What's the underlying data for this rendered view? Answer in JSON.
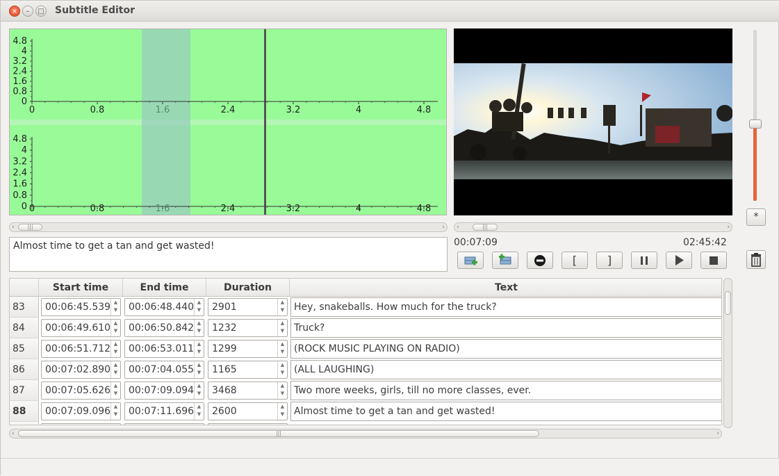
{
  "window": {
    "title": "Subtitle Editor"
  },
  "waveform": {
    "y_ticks": [
      "4.8",
      "4",
      "3.2",
      "2.4",
      "1.6",
      "0.8",
      "0"
    ],
    "x_ticks": [
      "0",
      "0.8",
      "1.6",
      "2.4",
      "3.2",
      "4",
      "4.8"
    ],
    "background_color": "#98fb98",
    "selection_color": "#98cebc"
  },
  "player": {
    "current_time": "00:07:09",
    "total_time": "02:45:42",
    "volume_level": 0.45,
    "volume_button_label": "*",
    "accent_color": "#e5633b"
  },
  "editor": {
    "text": "Almost time to get a tan and get wasted!"
  },
  "controls": {
    "insert_before_icon": "insert-before-icon",
    "insert_after_icon": "insert-after-icon",
    "remove_icon": "remove-icon",
    "mark_start_label": "[",
    "mark_end_label": "]",
    "pause_icon": "pause-icon",
    "play_icon": "play-icon",
    "stop_icon": "stop-icon",
    "delete_icon": "trash-icon"
  },
  "table": {
    "headers": {
      "start": "Start time",
      "end": "End time",
      "duration": "Duration",
      "text": "Text"
    },
    "rows": [
      {
        "num": "83",
        "start": "00:06:45.539",
        "end": "00:06:48.440",
        "duration": "2901",
        "text": "Hey, snakeballs. How much for the truck?"
      },
      {
        "num": "84",
        "start": "00:06:49.610",
        "end": "00:06:50.842",
        "duration": "1232",
        "text": "Truck?"
      },
      {
        "num": "85",
        "start": "00:06:51.712",
        "end": "00:06:53.011",
        "duration": "1299",
        "text": "(ROCK MUSIC PLAYING ON RADIO)"
      },
      {
        "num": "86",
        "start": "00:07:02.890",
        "end": "00:07:04.055",
        "duration": "1165",
        "text": "(ALL LAUGHING)"
      },
      {
        "num": "87",
        "start": "00:07:05.626",
        "end": "00:07:09.094",
        "duration": "3468",
        "text": "Two more weeks, girls, till no more classes, ever."
      },
      {
        "num": "88",
        "start": "00:07:09.096",
        "end": "00:07:11.696",
        "duration": "2600",
        "text": "Almost time to get a tan and get wasted!"
      }
    ],
    "current_row": "88"
  }
}
